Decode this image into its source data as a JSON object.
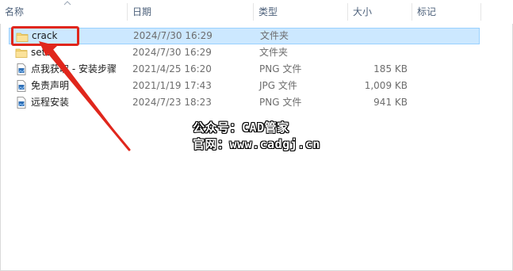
{
  "columns": {
    "name": "名称",
    "date": "日期",
    "type": "类型",
    "size": "大小",
    "tag": "标记"
  },
  "files": [
    {
      "name": "crack",
      "date": "2024/7/30 16:29",
      "type": "文件夹",
      "size": "",
      "icon": "folder-icon",
      "selected": true
    },
    {
      "name": "setu",
      "date": "2024/7/30 16:29",
      "type": "文件夹",
      "size": "",
      "icon": "folder-icon",
      "selected": false
    },
    {
      "name": "点我获取 - 安装步骤",
      "date": "2021/4/25 16:20",
      "type": "PNG 文件",
      "size": "185 KB",
      "icon": "image-file-icon",
      "selected": false
    },
    {
      "name": "免责声明",
      "date": "2021/1/19 17:43",
      "type": "JPG 文件",
      "size": "1,009 KB",
      "icon": "image-file-icon",
      "selected": false
    },
    {
      "name": "远程安装",
      "date": "2024/7/23 18:23",
      "type": "PNG 文件",
      "size": "941 KB",
      "icon": "image-file-icon",
      "selected": false
    }
  ],
  "watermark": {
    "line1": "公众号：CAD管家",
    "line2": "官网：www.cadgj.cn"
  },
  "colors": {
    "selection_bg": "#cce8ff",
    "selection_border": "#99d1ff",
    "annotation_red": "#e0261c",
    "folder_yellow": "#f8d775"
  }
}
